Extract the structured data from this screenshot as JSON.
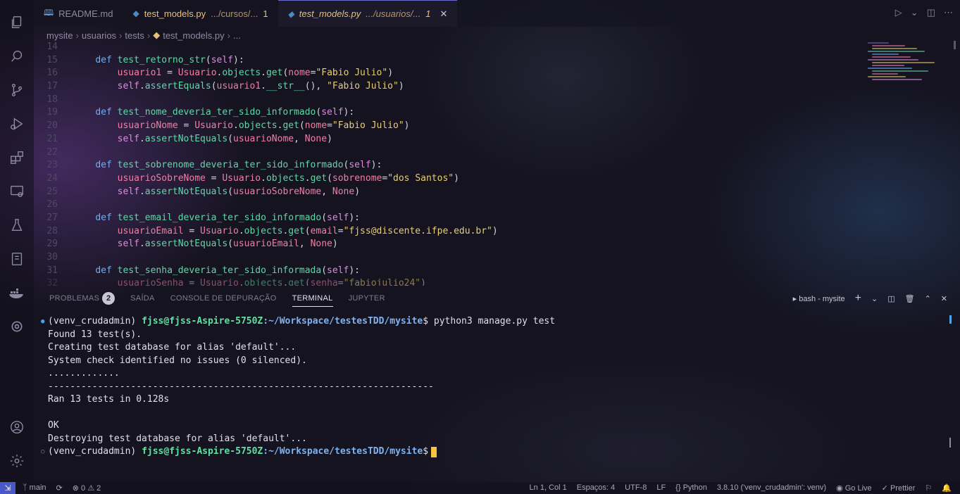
{
  "tabs": [
    {
      "icon": "readme-icon",
      "label": "README.md",
      "path": "",
      "mod": "",
      "active": false
    },
    {
      "icon": "python-icon",
      "label": "test_models.py",
      "path": ".../cursos/...",
      "mod": "1",
      "active": false
    },
    {
      "icon": "python-icon",
      "label": "test_models.py",
      "path": ".../usuarios/...",
      "mod": "1",
      "active": true
    }
  ],
  "breadcrumb": [
    "mysite",
    "usuarios",
    "tests",
    "test_models.py",
    "..."
  ],
  "code_lines": [
    {
      "n": "14",
      "html": ""
    },
    {
      "n": "15",
      "html": "    <span class='kw'>def</span> <span class='fn'>test_retorno_str</span>(<span class='self'>self</span>):"
    },
    {
      "n": "16",
      "html": "        <span class='var'>usuario1</span> = <span class='var'>Usuario</span>.<span class='fn'>objects</span>.<span class='fn'>get</span>(<span class='var'>nome</span>=<span class='str'>\"Fabio Julio\"</span>)"
    },
    {
      "n": "17",
      "html": "        <span class='self'>self</span>.<span class='fn'>assertEquals</span>(<span class='var'>usuario1</span>.<span class='fn'>__str__</span>(), <span class='str'>\"Fabio Julio\"</span>)"
    },
    {
      "n": "18",
      "html": ""
    },
    {
      "n": "19",
      "html": "    <span class='kw'>def</span> <span class='fn'>test_nome_deveria_ter_sido_informado</span>(<span class='self'>self</span>):"
    },
    {
      "n": "20",
      "html": "        <span class='var'>usuarioNome</span> = <span class='var'>Usuario</span>.<span class='fn'>objects</span>.<span class='fn'>get</span>(<span class='var'>nome</span>=<span class='str'>\"Fabio Julio\"</span>)"
    },
    {
      "n": "21",
      "html": "        <span class='self'>self</span>.<span class='fn'>assertNotEquals</span>(<span class='var'>usuarioNome</span>, <span class='none'>None</span>)"
    },
    {
      "n": "22",
      "html": ""
    },
    {
      "n": "23",
      "html": "    <span class='kw'>def</span> <span class='fn'>test_sobrenome_deveria_ter_sido_informado</span>(<span class='self'>self</span>):"
    },
    {
      "n": "24",
      "html": "        <span class='var'>usuarioSobreNome</span> = <span class='var'>Usuario</span>.<span class='fn'>objects</span>.<span class='fn'>get</span>(<span class='var'>sobrenome</span>=<span class='str'>\"dos Santos\"</span>)"
    },
    {
      "n": "25",
      "html": "        <span class='self'>self</span>.<span class='fn'>assertNotEquals</span>(<span class='var'>usuarioSobreNome</span>, <span class='none'>None</span>)"
    },
    {
      "n": "26",
      "html": ""
    },
    {
      "n": "27",
      "html": "    <span class='kw'>def</span> <span class='fn'>test_email_deveria_ter_sido_informado</span>(<span class='self'>self</span>):"
    },
    {
      "n": "28",
      "html": "        <span class='var'>usuarioEmail</span> = <span class='var'>Usuario</span>.<span class='fn'>objects</span>.<span class='fn'>get</span>(<span class='var'>email</span>=<span class='str'>\"fjss@discente.ifpe.edu.br\"</span>)"
    },
    {
      "n": "29",
      "html": "        <span class='self'>self</span>.<span class='fn'>assertNotEquals</span>(<span class='var'>usuarioEmail</span>, <span class='none'>None</span>)"
    },
    {
      "n": "30",
      "html": ""
    },
    {
      "n": "31",
      "html": "    <span class='kw'>def</span> <span class='fn'>test_senha_deveria_ter_sido_informada</span>(<span class='self'>self</span>):"
    },
    {
      "n": "32",
      "html": "        <span class='var'>usuarioSenha</span> = <span class='var'>Usuario</span>.<span class='fn'>objects</span>.<span class='fn'>get</span>(<span class='var'>senha</span>=<span class='str'>\"fabiojulio24\"</span>)"
    }
  ],
  "panel": {
    "tabs": [
      "PROBLEMAS",
      "SAÍDA",
      "CONSOLE DE DEPURAÇÃO",
      "TERMINAL",
      "JUPYTER"
    ],
    "problems_count": "2",
    "active_tab": "TERMINAL",
    "shell_label": "bash - mysite"
  },
  "terminal": {
    "env": "(venv_crudadmin)",
    "user": "fjss@fjss-Aspire-5750Z",
    "path": ":~/Workspace/testesTDD/mysite",
    "symbol": "$",
    "command": "python3 manage.py test",
    "output": [
      "Found 13 test(s).",
      "Creating test database for alias 'default'...",
      "System check identified no issues (0 silenced).",
      ".............",
      "----------------------------------------------------------------------",
      "Ran 13 tests in 0.128s",
      "",
      "OK",
      "Destroying test database for alias 'default'..."
    ]
  },
  "statusbar": {
    "branch": "main",
    "errors": "0",
    "warnings": "2",
    "position": "Ln 1, Col 1",
    "spaces": "Espaços: 4",
    "encoding": "UTF-8",
    "eol": "LF",
    "language": "Python",
    "interpreter": "3.8.10 ('venv_crudadmin': venv)",
    "golive": "Go Live",
    "prettier": "Prettier"
  },
  "colors": {
    "accent": "#4a58c8",
    "terminal_user": "#5ee2a2",
    "terminal_path": "#7fb2f0"
  }
}
